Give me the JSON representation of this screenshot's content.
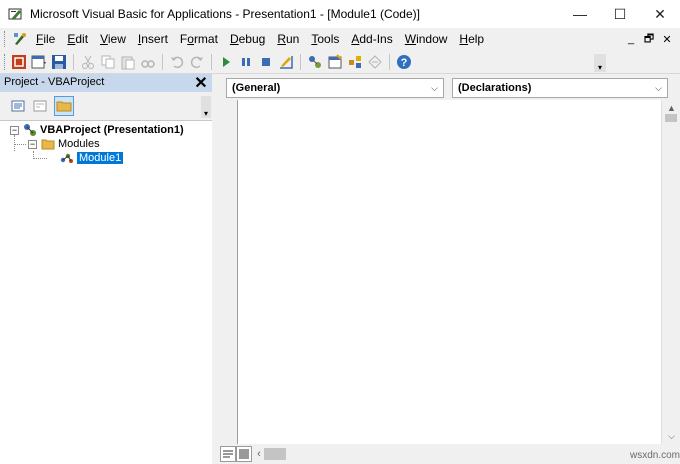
{
  "window": {
    "title": "Microsoft Visual Basic for Applications - Presentation1 - [Module1 (Code)]",
    "controls": {
      "minimize": "—",
      "maximize": "☐",
      "close": "✕"
    }
  },
  "menu": {
    "items": [
      {
        "underline": "F",
        "rest": "ile"
      },
      {
        "underline": "E",
        "rest": "dit"
      },
      {
        "underline": "V",
        "rest": "iew"
      },
      {
        "underline": "I",
        "rest": "nsert"
      },
      {
        "pre": "F",
        "underline": "o",
        "rest": "rmat"
      },
      {
        "underline": "D",
        "rest": "ebug"
      },
      {
        "underline": "R",
        "rest": "un"
      },
      {
        "underline": "T",
        "rest": "ools"
      },
      {
        "underline": "A",
        "rest": "dd-Ins"
      },
      {
        "underline": "W",
        "rest": "indow"
      },
      {
        "underline": "H",
        "rest": "elp"
      }
    ],
    "mdi_controls": {
      "minimize": "_",
      "restore": "🗗",
      "close": "✕"
    }
  },
  "toolbar": {
    "icons": [
      "view-host-icon",
      "insert-module-icon",
      "save-icon",
      "cut-icon",
      "copy-icon",
      "paste-icon",
      "find-icon",
      "undo-icon",
      "redo-icon",
      "run-icon",
      "break-icon",
      "reset-icon",
      "design-mode-icon",
      "project-explorer-icon",
      "properties-window-icon",
      "object-browser-icon",
      "toolbox-icon",
      "help-icon"
    ],
    "colors": {
      "run": "#2e8b3e",
      "help": "#2f6fbf",
      "disabled": "#b5b5b5"
    }
  },
  "project": {
    "title": "Project - VBAProject",
    "close_glyph": "✕",
    "tree": {
      "root": {
        "label": "VBAProject (Presentation1)",
        "expander": "−"
      },
      "folder": {
        "label": "Modules",
        "expander": "−"
      },
      "module": {
        "label": "Module1"
      }
    }
  },
  "code": {
    "object_combo": "(General)",
    "procedure_combo": "(Declarations)",
    "combo_arrow": "⌵"
  },
  "status": {
    "watermark": "wsxdn.com"
  }
}
